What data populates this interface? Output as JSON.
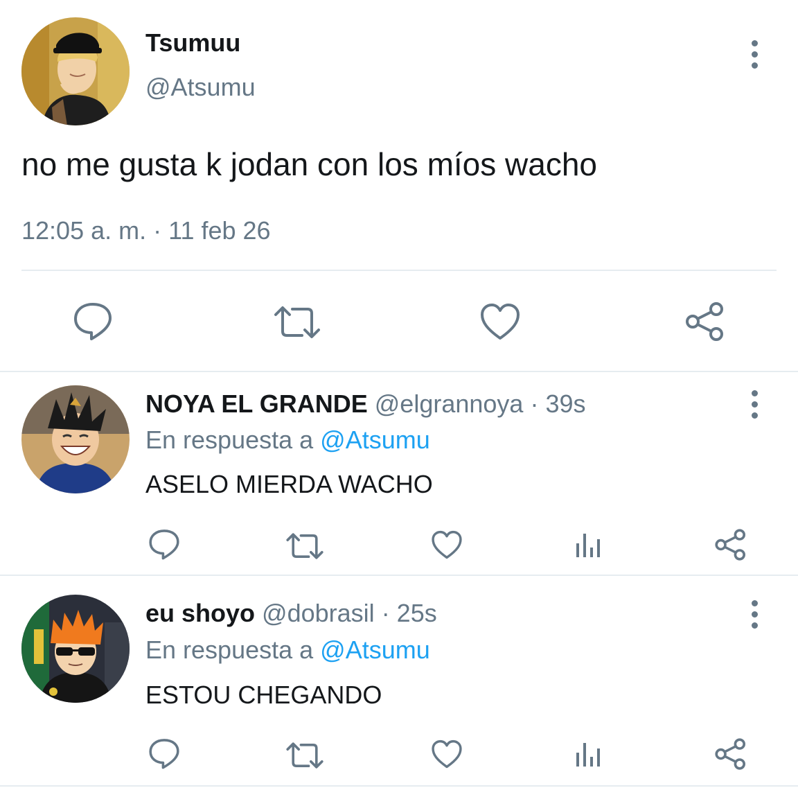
{
  "main_tweet": {
    "display_name": "Tsumuu",
    "handle": "@Atsumu",
    "text": "no me gusta k jodan con los míos wacho",
    "timestamp": "12:05 a. m. · 11 feb 26",
    "avatar_icon": "avatar-blond-man-cap",
    "action_icons": [
      "reply-icon",
      "retweet-icon",
      "like-icon",
      "share-icon"
    ]
  },
  "replies": [
    {
      "display_name": "NOYA EL GRANDE",
      "handle": "@elgrannoya",
      "time": "· 39s",
      "reply_prefix": "En respuesta a",
      "reply_to": "@Atsumu",
      "text": "ASELO MIERDA WACHO",
      "avatar_icon": "avatar-smiling-boy"
    },
    {
      "display_name": "eu shoyo",
      "handle": "@dobrasil",
      "time": "· 25s",
      "reply_prefix": "En respuesta a",
      "reply_to": "@Atsumu",
      "text": "ESTOU CHEGANDO",
      "avatar_icon": "avatar-orange-hair-sunglasses"
    }
  ],
  "colors": {
    "text": "#14171a",
    "muted": "#657786",
    "link": "#1da1f2",
    "divider": "#e6ecf0"
  }
}
